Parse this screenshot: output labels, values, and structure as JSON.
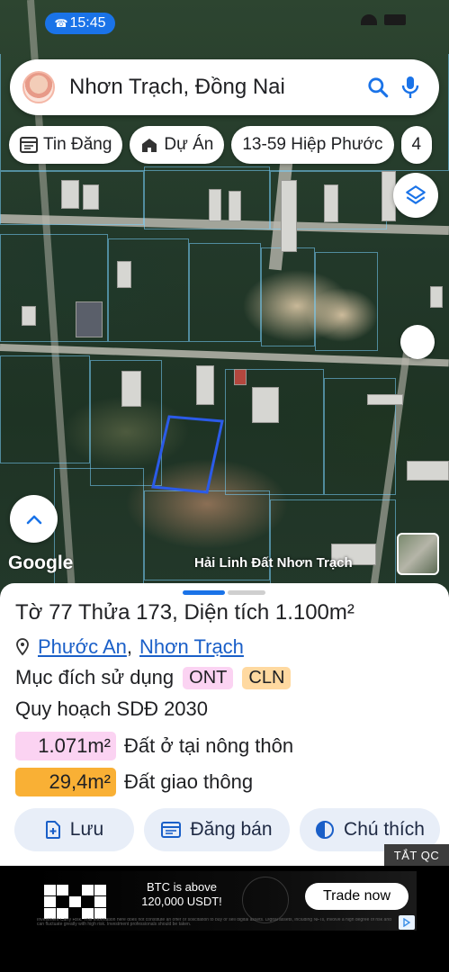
{
  "status_bar": {
    "time": "15:45"
  },
  "search": {
    "query": "Nhơn Trạch, Đồng Nai"
  },
  "chips": [
    {
      "label": "Tin Đăng",
      "icon": "listing-icon"
    },
    {
      "label": "Dự Án",
      "icon": "project-icon"
    },
    {
      "label": "13-59 Hiệp Phước",
      "icon": ""
    },
    {
      "label": "4",
      "icon": ""
    }
  ],
  "map": {
    "attribution": "Google",
    "label": "Hải Linh Đất Nhơn Trạch"
  },
  "parcel": {
    "title": "Tờ 77 Thửa 173, Diện tích 1.100m²",
    "ward": "Phước An",
    "district": "Nhơn Trạch",
    "separator": ",",
    "purpose_label": "Mục đích sử dụng",
    "purpose_tags": [
      "ONT",
      "CLN"
    ],
    "plan_label": "Quy hoạch SDĐ 2030",
    "areas": [
      {
        "value": "1.071m²",
        "label": "Đất ở tại nông thôn",
        "color": "#fbd3f2"
      },
      {
        "value": "29,4m²",
        "label": "Đất giao thông",
        "color": "#f9b035"
      }
    ]
  },
  "actions": {
    "save": "Lưu",
    "post": "Đăng bán",
    "legend": "Chú thích"
  },
  "ad": {
    "tag": "TẮT QC",
    "brand": "OKX",
    "headline": "BTC is above 120,000 USDT!",
    "cta": "Trade now",
    "fine_print": "Investment Carry Risk. This information here does not constitute an offer or solicitation to buy or sell digital assets. Digital assets, including NFTs, involve a high degree of risk and can fluctuate greatly with high risk. Investment professionals should be taken."
  },
  "colors": {
    "accent": "#1a73e8",
    "ont": "#fbd3f2",
    "cln": "#ffd9a0"
  }
}
